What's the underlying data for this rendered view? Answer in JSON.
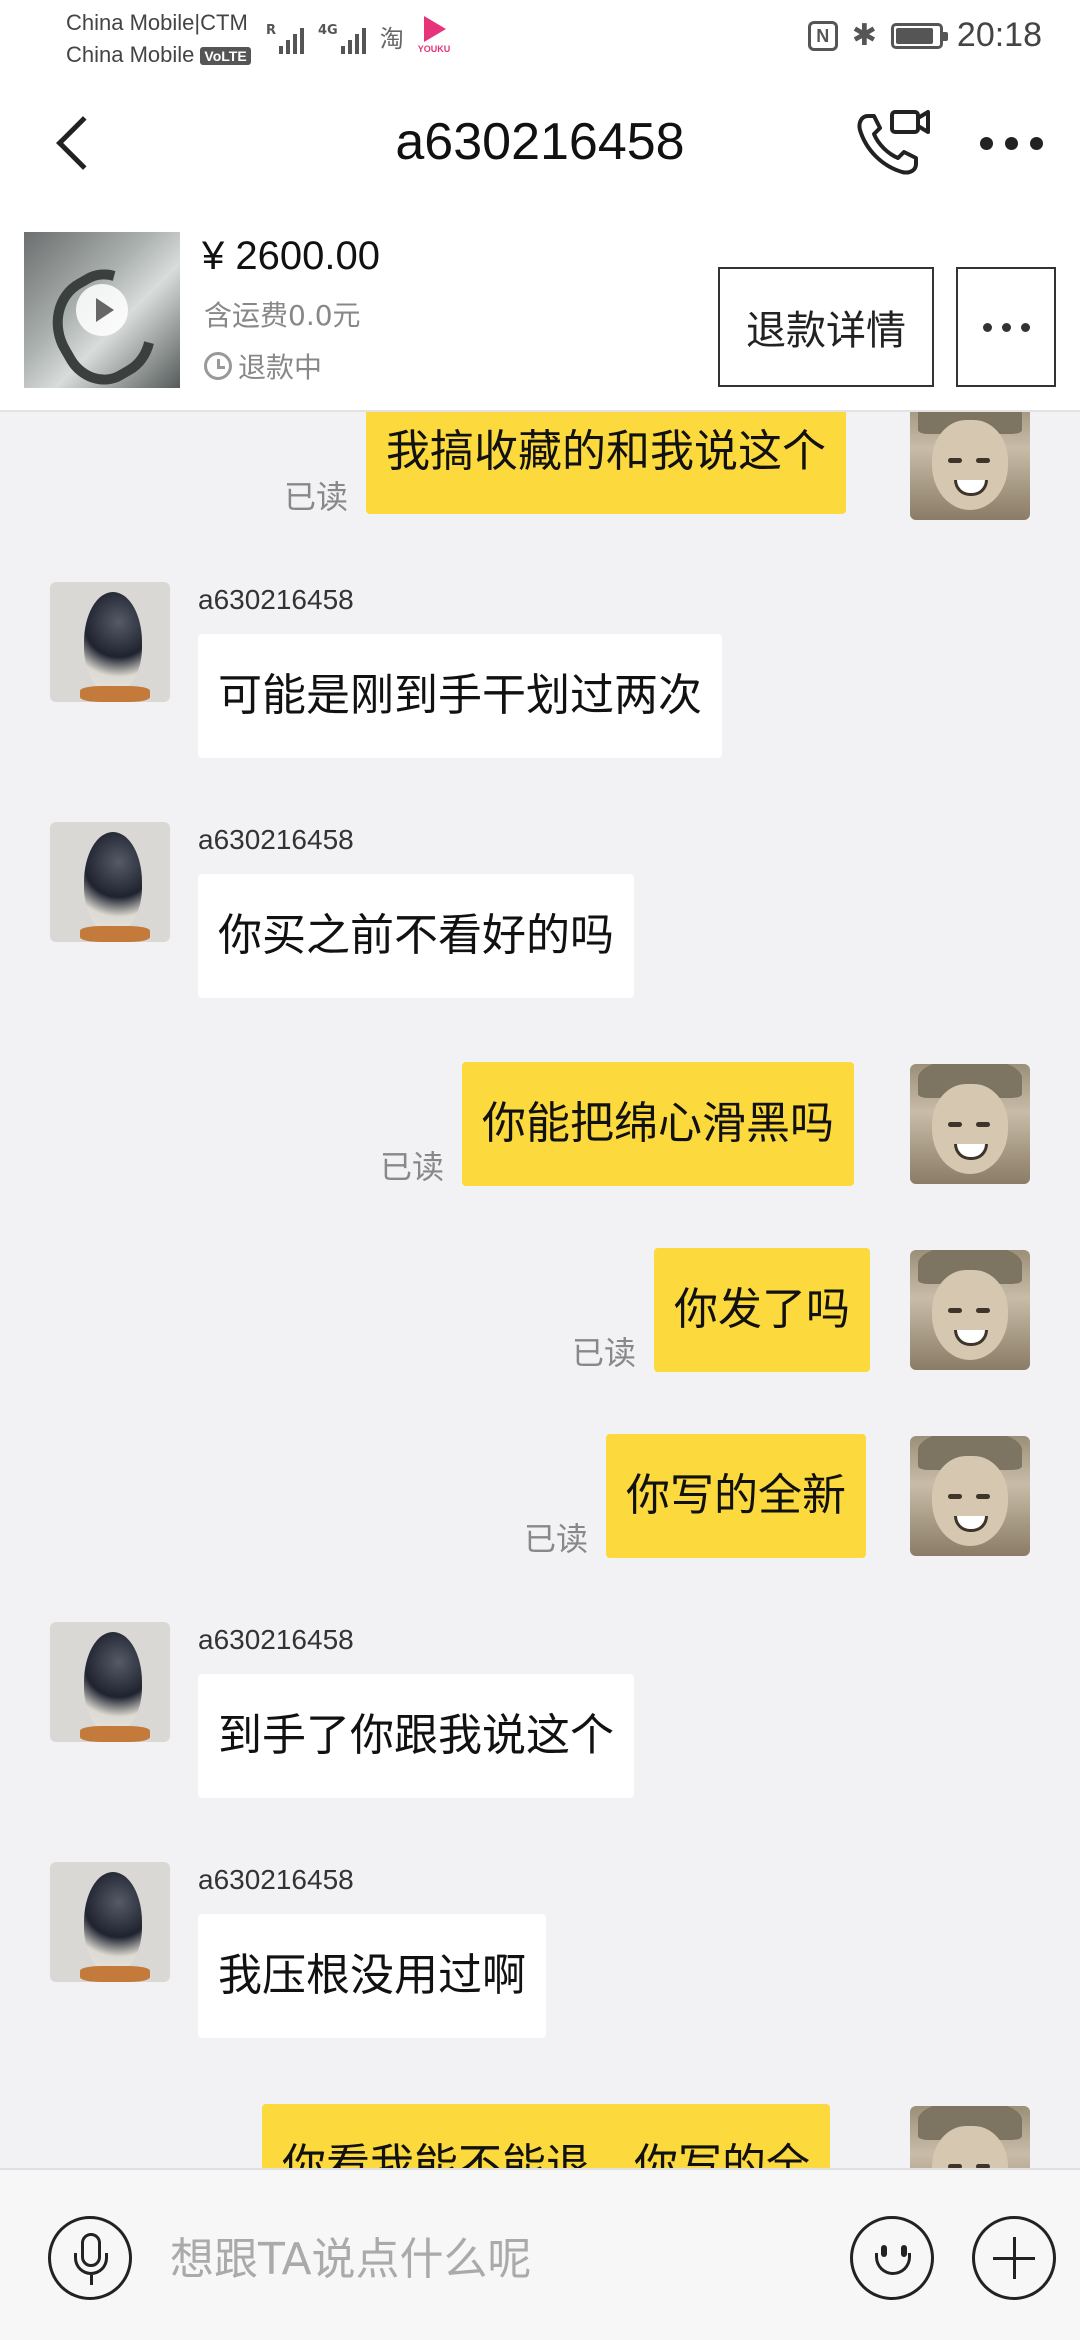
{
  "status_bar": {
    "carrier1": "China Mobile|CTM",
    "carrier2": "China Mobile",
    "volte": "VoLTE",
    "sim1_label": "R",
    "sim2_label": "4G",
    "taobao_icon": "淘",
    "youku_label": "YOUKU",
    "nfc_label": "N",
    "time": "20:18"
  },
  "nav": {
    "title": "a630216458"
  },
  "order": {
    "price": "¥ 2600.00",
    "shipping": "含运费0.0元",
    "status": "退款中",
    "refund_details_label": "退款详情"
  },
  "messages": [
    {
      "from": "self",
      "text": "我搞收藏的和我说这个",
      "read": "已读"
    },
    {
      "from": "other",
      "name": "a630216458",
      "text": "可能是刚到手干划过两次"
    },
    {
      "from": "other",
      "name": "a630216458",
      "text": "你买之前不看好的吗"
    },
    {
      "from": "self",
      "text": "你能把绵心滑黑吗",
      "read": "已读"
    },
    {
      "from": "self",
      "text": "你发了吗",
      "read": "已读"
    },
    {
      "from": "self",
      "text": "你写的全新",
      "read": "已读"
    },
    {
      "from": "other",
      "name": "a630216458",
      "text": "到手了你跟我说这个"
    },
    {
      "from": "other",
      "name": "a630216458",
      "text": "我压根没用过啊"
    },
    {
      "from": "self",
      "text": "你看我能不能退，你写的全"
    }
  ],
  "input": {
    "placeholder": "想跟TA说点什么呢"
  },
  "colors": {
    "self_bubble": "#fcd93c",
    "other_bubble": "#ffffff",
    "chat_background": "#f2f2f4"
  }
}
